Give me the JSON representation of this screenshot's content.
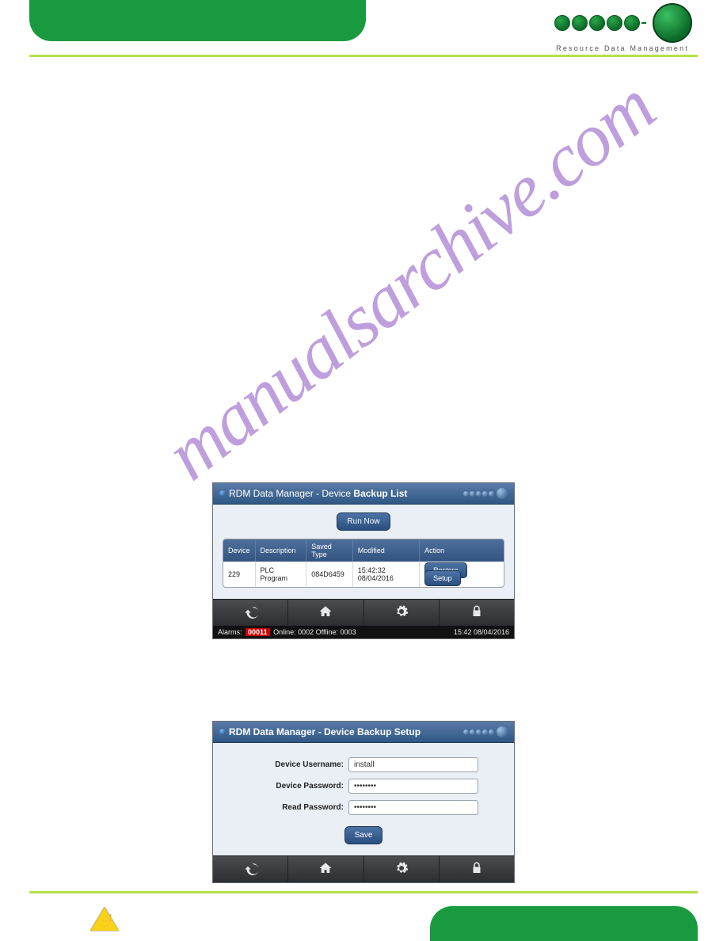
{
  "brand": {
    "tagline": "Resource Data Management"
  },
  "watermark": "manualsarchive.com",
  "shot1": {
    "title_prefix": "RDM Data Manager - Device",
    "title_suffix": " Backup List",
    "run_now": "Run Now",
    "headers": {
      "device": "Device",
      "description": "Description",
      "saved_type": "Saved Type",
      "modified": "Modified",
      "action": "Action"
    },
    "row": {
      "device": "229",
      "description": "PLC Program",
      "saved_type": "084D6459",
      "modified": "15:42:32 08/04/2016",
      "restore_label": "Restore",
      "setup_label": "Setup"
    },
    "status": {
      "alarms_label": "Alarms:",
      "alarms_count": "00011",
      "online_label": "Online:",
      "online_count": "0002",
      "offline_label": "Offline:",
      "offline_count": "0003",
      "clock": "15:42 08/04/2016"
    }
  },
  "shot2": {
    "title": "RDM Data Manager - Device Backup Setup",
    "fields": {
      "username_label": "Device Username:",
      "username_value": "install",
      "devpass_label": "Device Password:",
      "devpass_value": "••••••••",
      "readpass_label": "Read Password:",
      "readpass_value": "••••••••"
    },
    "save_label": "Save"
  }
}
